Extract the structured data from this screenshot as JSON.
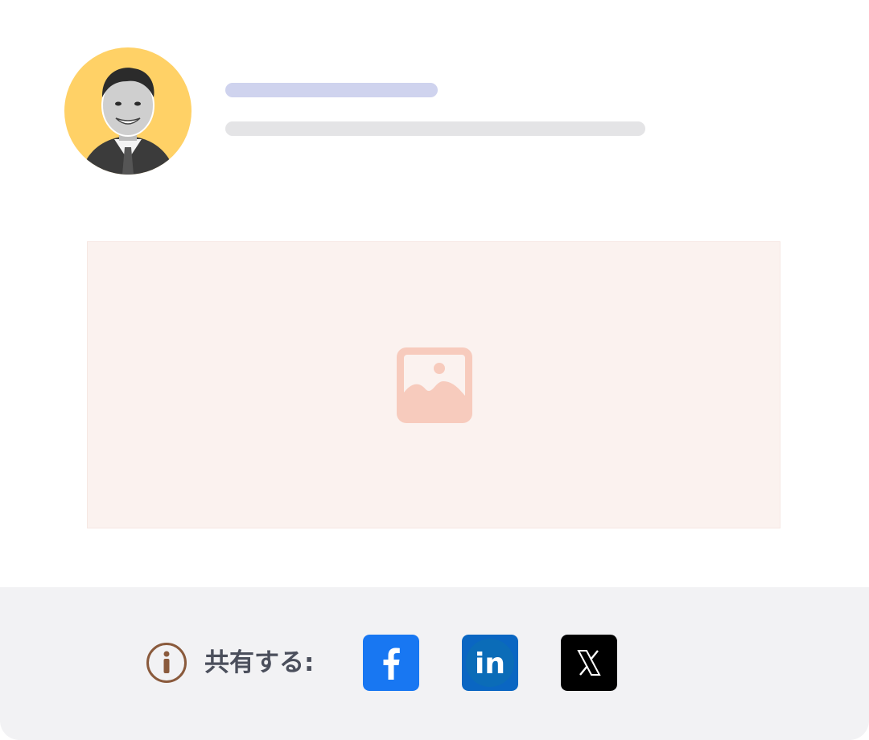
{
  "colors": {
    "avatar_bg": "#ffd166",
    "skeleton_title": "#cfd3ee",
    "skeleton_sub": "#e4e4e6",
    "placeholder_bg": "#fbf2ef",
    "placeholder_icon": "#f7cbbd",
    "footer_bg": "#f2f2f4",
    "info_icon": "#8a5a3c",
    "label_text": "#4b4f5c",
    "facebook": "#1877f2",
    "linkedin": "#0a66c2",
    "x": "#000000"
  },
  "header": {
    "avatar_icon": "person-photo"
  },
  "media": {
    "icon": "image-icon"
  },
  "footer": {
    "info_icon": "info-icon",
    "share_label": "共有する:",
    "social": [
      {
        "name": "facebook",
        "icon": "facebook-icon"
      },
      {
        "name": "linkedin",
        "icon": "linkedin-icon",
        "glyph": "in"
      },
      {
        "name": "x",
        "icon": "x-icon"
      }
    ]
  }
}
